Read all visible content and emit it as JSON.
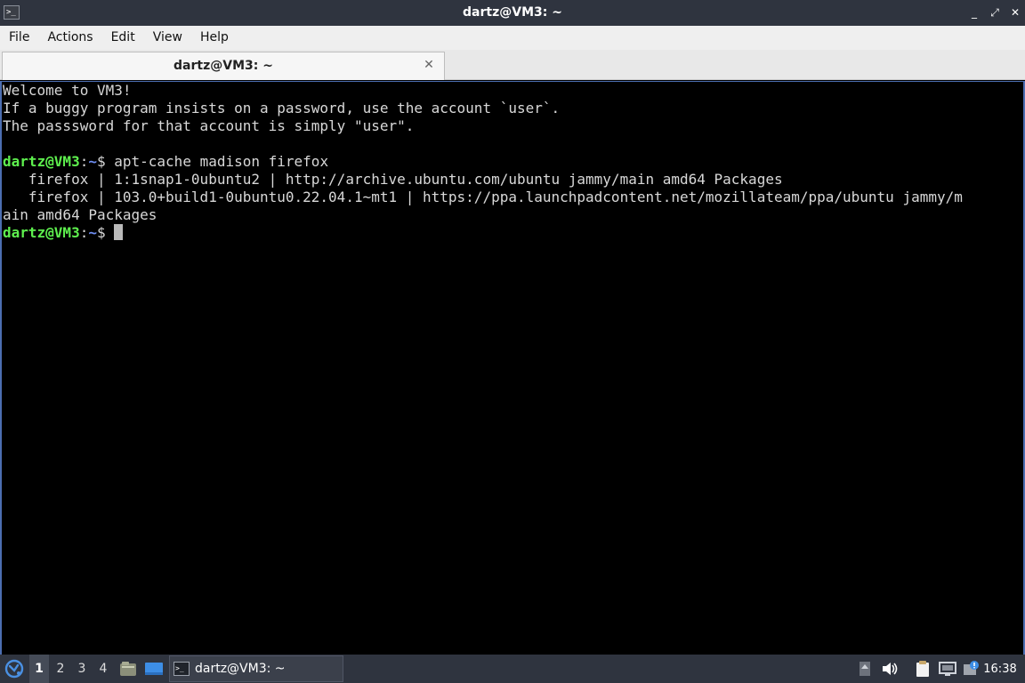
{
  "window": {
    "title": "dartz@VM3: ~",
    "app_icon_glyph": ">_",
    "controls": {
      "minimize": "_",
      "maximize": "⤢",
      "close": "✕"
    }
  },
  "menu": [
    "File",
    "Actions",
    "Edit",
    "View",
    "Help"
  ],
  "tab": {
    "label": "dartz@VM3: ~",
    "close": "✕"
  },
  "terminal": {
    "motd": [
      "Welcome to VM3!",
      "If a buggy program insists on a password, use the account `user`.",
      "The passsword for that account is simply \"user\"."
    ],
    "prompt": {
      "user_host": "dartz@VM3",
      "sep": ":",
      "path": "~",
      "symbol": "$ "
    },
    "command": "apt-cache madison firefox",
    "output": [
      "   firefox | 1:1snap1-0ubuntu2 | http://archive.ubuntu.com/ubuntu jammy/main amd64 Packages",
      "   firefox | 103.0+build1-0ubuntu0.22.04.1~mt1 | https://ppa.launchpadcontent.net/mozillateam/ppa/ubuntu jammy/m",
      "ain amd64 Packages"
    ],
    "colors": {
      "user_host": "#5ef04e",
      "path": "#6f8ff3",
      "text": "#d8d8d8",
      "background": "#000000"
    }
  },
  "taskbar": {
    "desktops": [
      "1",
      "2",
      "3",
      "4"
    ],
    "active_desktop": "1",
    "task_label": "dartz@VM3: ~",
    "clock": "16:38",
    "tray_icons": [
      "upload-icon",
      "volume-icon",
      "clipboard-icon",
      "network-icon",
      "update-notifier-icon"
    ]
  }
}
